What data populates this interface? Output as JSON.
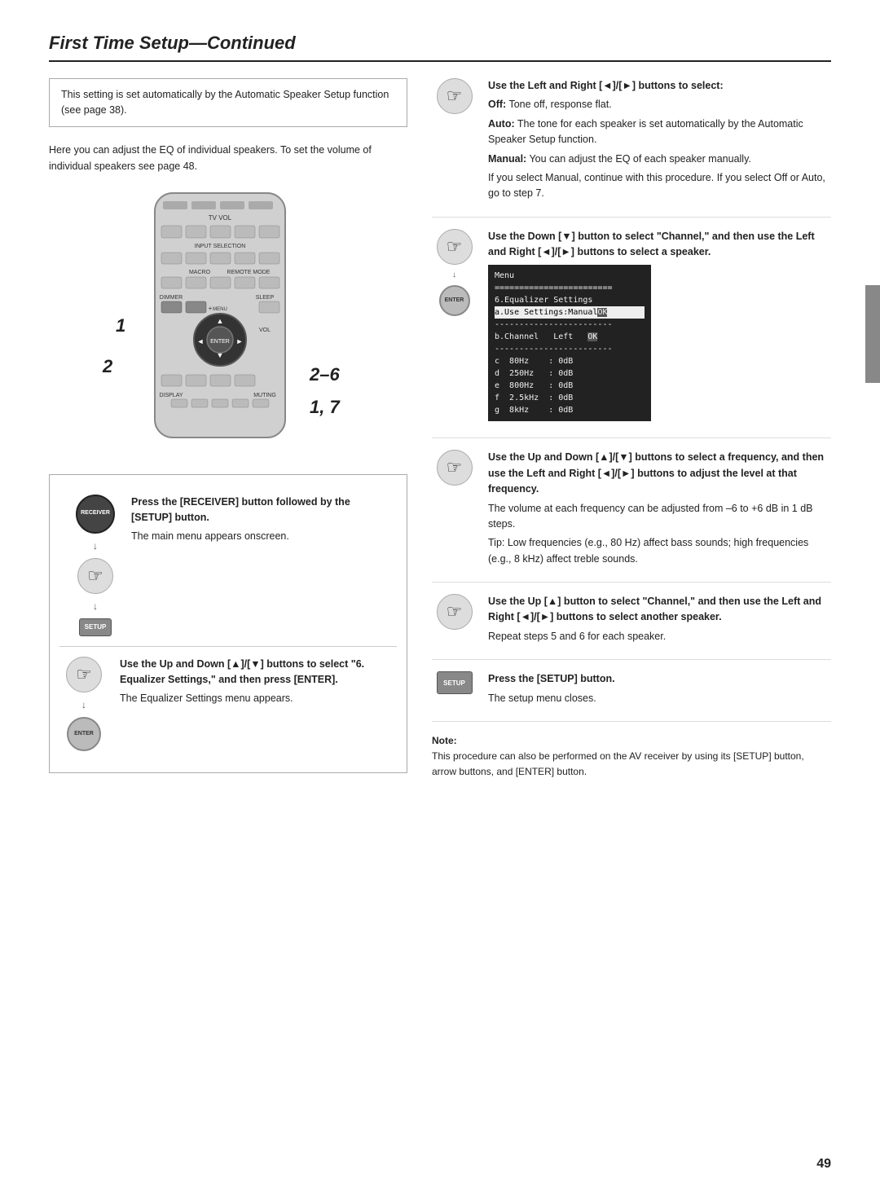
{
  "page": {
    "title_bold": "First Time Setup",
    "title_italic": "—Continued",
    "page_number": "49"
  },
  "left": {
    "info_box": "This setting is set automatically by the Automatic Speaker Setup function (see page 38).",
    "intro": "Here you can adjust the EQ of individual speakers. To set the volume of individual speakers see page 48.",
    "remote_labels": {
      "label1": "1",
      "label2": "2",
      "label26": "2–6",
      "label17": "1, 7"
    },
    "step1": {
      "title": "Press the [RECEIVER] button followed by the [SETUP] button.",
      "body": "The main menu appears onscreen."
    },
    "step2": {
      "title": "Use the Up and Down [▲]/[▼] buttons to select \"6. Equalizer Settings,\" and then press [ENTER].",
      "body": "The Equalizer Settings menu appears."
    }
  },
  "right": {
    "step3": {
      "title": "Use the Left and Right [◄]/[►] buttons to select:",
      "items": [
        {
          "label": "Off:",
          "text": "Tone off, response flat."
        },
        {
          "label": "Auto:",
          "text": "The tone for each speaker is set automatically by the Automatic Speaker Setup function."
        },
        {
          "label": "Manual:",
          "text": "You can adjust the EQ of each speaker manually."
        }
      ],
      "note": "If you select Manual, continue with this procedure. If you select Off or Auto, go to step 7."
    },
    "step4": {
      "title": "Use the Down [▼] button to select \"Channel,\" and then use the Left and Right [◄]/[►] buttons to select a speaker.",
      "menu": {
        "title": "Menu",
        "lines": [
          "6.Equalizer Settings",
          "a.Use Settings:Manual OK",
          "b.Channel   Left   OK",
          "c  80Hz    : 0dB",
          "d  250Hz   : 0dB",
          "e  800Hz   : 0dB",
          "f  2.5kHz  : 0dB",
          "g  8kHz    : 0dB"
        ]
      }
    },
    "step5": {
      "title": "Use the Up and Down [▲]/[▼] buttons to select a frequency, and then use the Left and Right [◄]/[►] buttons to adjust the level at that frequency.",
      "body1": "The volume at each frequency can be adjusted from –6 to +6 dB in 1 dB steps.",
      "tip": "Tip: Low frequencies (e.g., 80 Hz) affect bass sounds; high frequencies (e.g., 8 kHz) affect treble sounds."
    },
    "step6": {
      "title": "Use the Up [▲] button to select \"Channel,\" and then use the Left and Right [◄]/[►] buttons to select another speaker.",
      "body": "Repeat steps 5 and 6 for each speaker."
    },
    "step7": {
      "title": "Press the [SETUP] button.",
      "body": "The setup menu closes."
    },
    "note": {
      "label": "Note:",
      "text": "This procedure can also be performed on the AV receiver by using its [SETUP] button, arrow buttons, and [ENTER] button."
    }
  }
}
